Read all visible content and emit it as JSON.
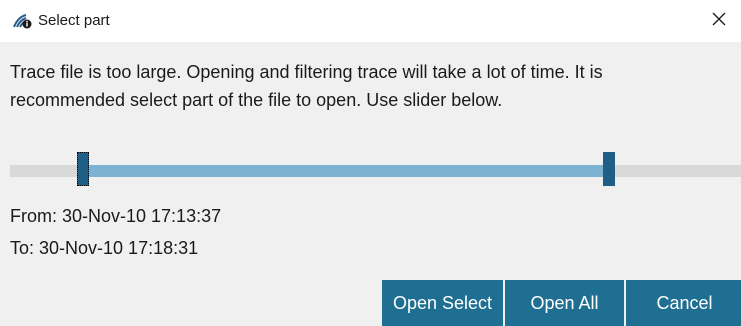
{
  "window": {
    "title": "Select part",
    "app_icon": "signal-document-icon",
    "close_icon": "close-icon"
  },
  "message": "Trace file is too large. Opening and filtering trace will take a lot of time.  It is recommended select part of the file to open. Use slider below.",
  "slider": {
    "selection_start_fraction": 0.1,
    "selection_end_fraction": 0.82,
    "colors": {
      "track": "#d9d9d9",
      "range": "#7cb3d2",
      "thumb": "#1f5f86"
    }
  },
  "range": {
    "from": "From: 30-Nov-10 17:13:37",
    "to": "To: 30-Nov-10 17:18:31"
  },
  "buttons": {
    "open_select": "Open Select",
    "open_all": "Open All",
    "cancel": "Cancel",
    "color": "#1f6f93"
  }
}
